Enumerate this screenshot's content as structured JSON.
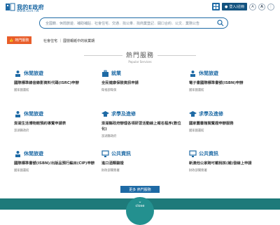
{
  "header": {
    "logo_text": "我的E政府",
    "logo_sub": "WWW.GOV.TW",
    "login_label": "登入/註冊",
    "font_a": "A",
    "font_b": "A"
  },
  "search": {
    "keywords": "全國籍．休閒旅遊．補助補貼．社會住宅．交通．找公車．找商業登記．開口合約．公文．業務公告"
  },
  "hot": {
    "tag_label": "熱門服務",
    "links": "社會住宅 ｜ 國營報紙中的就業期"
  },
  "section": {
    "title": "熱門服務",
    "subtitle": "Popular Services"
  },
  "cards": [
    {
      "category": "休閒旅遊",
      "title": "國際標準錄音錄影資料代碼(ISRC)申辦",
      "agency": "國家圖書館"
    },
    {
      "category": "就業",
      "title": "全民健康保險資訊申請",
      "agency": "衛福部衛保"
    },
    {
      "category": "休閒旅遊",
      "title": "電子書國際標準書號(ISBN)申辦",
      "agency": "國家圖書館"
    },
    {
      "category": "休閒旅遊",
      "title": "澎湖生活博物館預約導覽申請表",
      "agency": "澎湖縣政府"
    },
    {
      "category": "求學及進修",
      "title": "澎湖縣政府辦理各項研習活動線上報名程序(數位化)",
      "agency": "澎湖縣政府"
    },
    {
      "category": "求學及進修",
      "title": "國家圖書館閱覽證申辦服務",
      "agency": "國家圖書館"
    },
    {
      "category": "休閒旅遊",
      "title": "國際標準書號(ISBN)/出版品預行編目(CIP)申辦",
      "agency": "國家圖書館"
    },
    {
      "category": "公共資訊",
      "title": "進口酒類驗證",
      "agency": "財政部關務署"
    },
    {
      "category": "公共資訊",
      "title": "新澳他公家跨可載稅核(補)發線上申請",
      "agency": "財政部關務署"
    }
  ],
  "more_label": "更多 熱門服務",
  "close_label": "close",
  "colors": {
    "primary": "#1e6aa5",
    "hot_tag": "#e85d2a",
    "bottom": "#1e7a7a"
  }
}
